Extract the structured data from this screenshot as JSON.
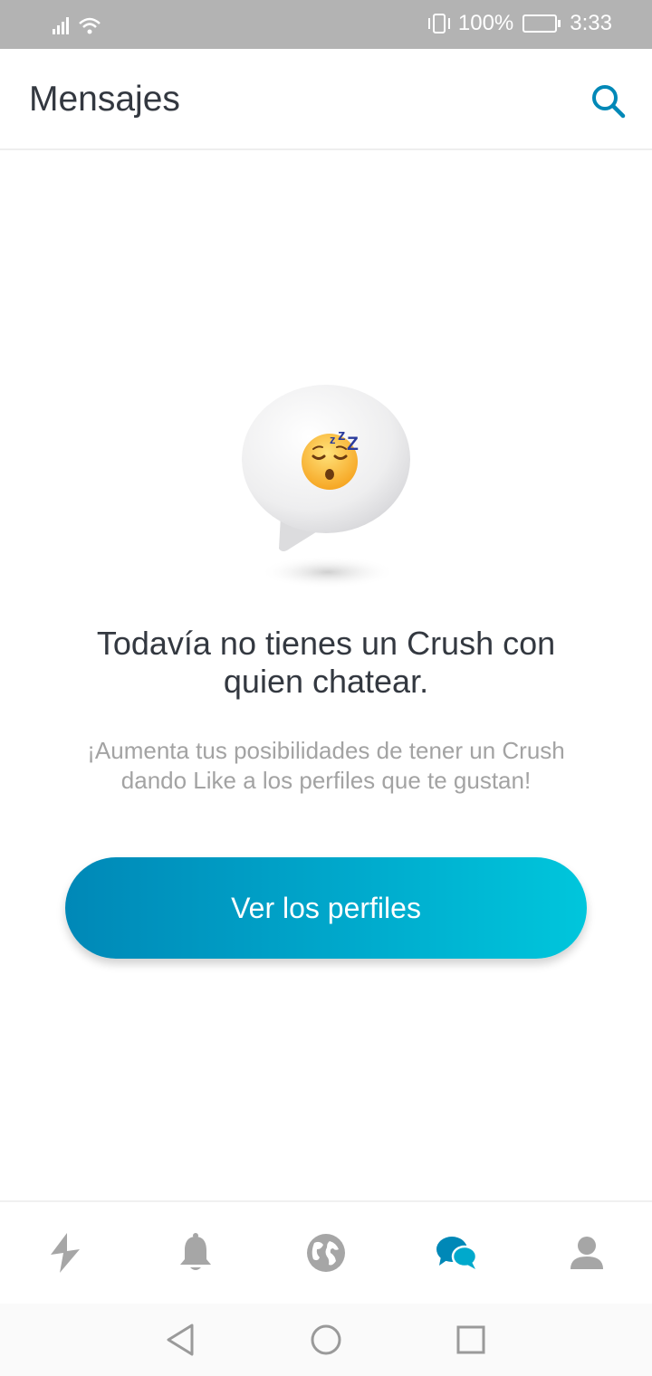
{
  "status_bar": {
    "battery": "100%",
    "time": "3:33"
  },
  "header": {
    "title": "Mensajes",
    "search_icon": "search-icon"
  },
  "empty_state": {
    "illustration": "sleeping-chat-bubble",
    "title_line1": "Todavía no tienes un Crush con",
    "title_line2": "quien chatear.",
    "subtitle_line1": "¡Aumenta tus posibilidades de tener un Crush",
    "subtitle_line2": "dando Like a los perfiles que te gustan!",
    "cta_label": "Ver los perfiles"
  },
  "bottom_nav": {
    "items": [
      {
        "icon": "lightning-icon",
        "active": false
      },
      {
        "icon": "bell-icon",
        "active": false
      },
      {
        "icon": "globe-icon",
        "active": false
      },
      {
        "icon": "chat-bubbles-icon",
        "active": true
      },
      {
        "icon": "profile-icon",
        "active": false
      }
    ]
  },
  "colors": {
    "accent": "#0088b7",
    "accent_light": "#00c6dc",
    "inactive_icon": "#a6a6a6",
    "title_text": "#333840",
    "subtitle_text": "#a3a3a3"
  }
}
